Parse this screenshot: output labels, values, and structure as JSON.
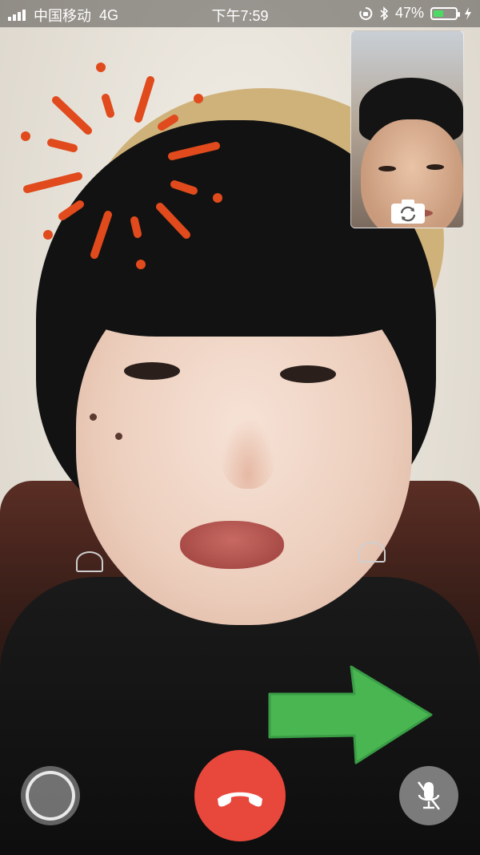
{
  "status_bar": {
    "carrier": "中国移动",
    "network": "4G",
    "time": "下午7:59",
    "battery_percent": "47%",
    "battery_level": 0.47,
    "signal_bars": 4
  },
  "icons": {
    "orientation_lock": "orientation-lock-icon",
    "bluetooth": "bluetooth-icon",
    "battery": "battery-icon",
    "charging": "charging-bolt-icon",
    "camera_switch": "camera-switch-icon",
    "record": "record-icon",
    "hangup": "phone-hangup-icon",
    "mute": "mic-mute-icon"
  },
  "colors": {
    "hangup": "#e8473b",
    "battery_fill": "#4cd964",
    "sticker_orange": "#e04a1c",
    "sticker_green": "#49b651"
  }
}
